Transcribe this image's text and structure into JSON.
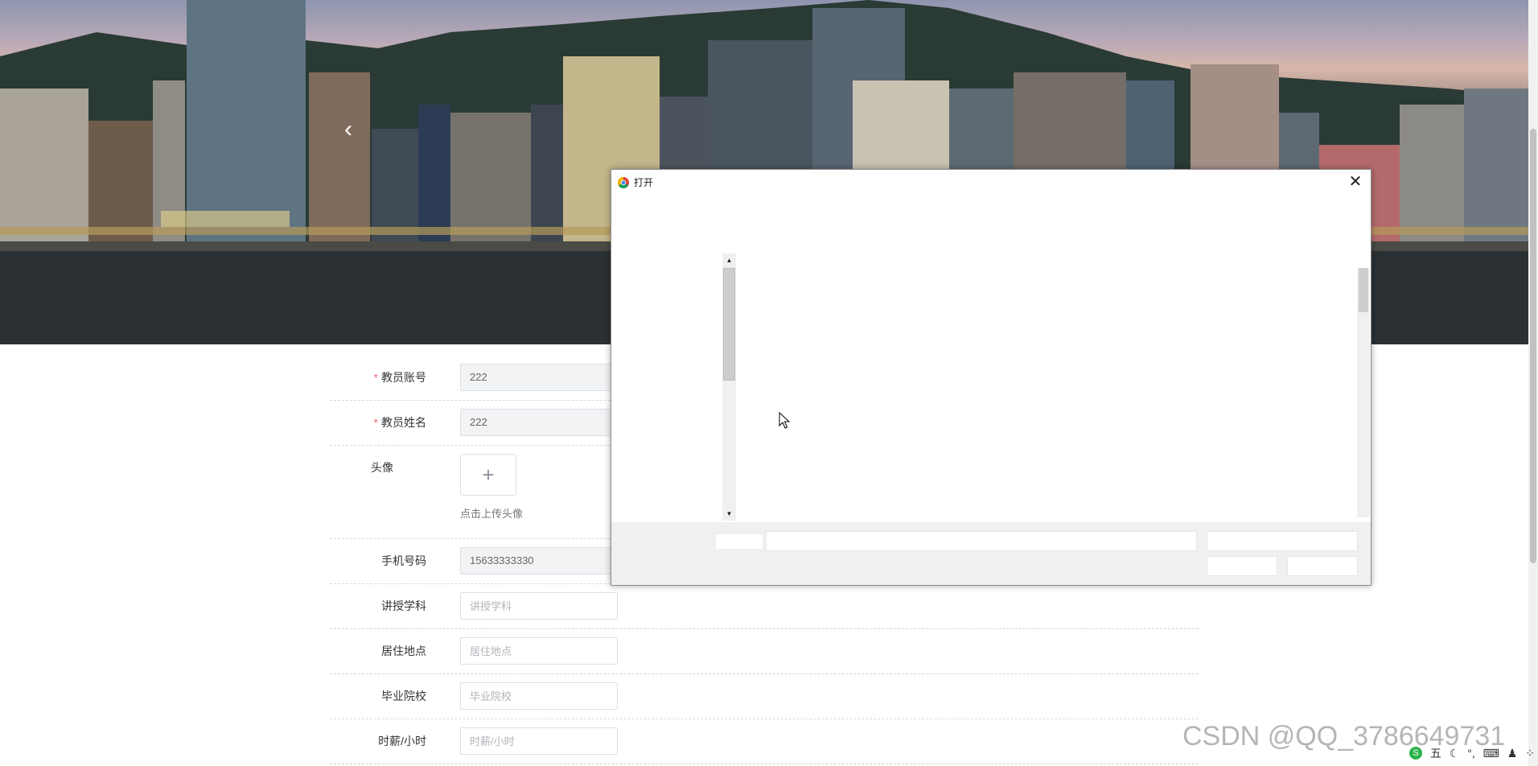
{
  "dialog": {
    "title": "打开",
    "close_glyph": "✕"
  },
  "banner": {
    "prev_glyph": "‹"
  },
  "form": {
    "account": {
      "label": "教员账号",
      "required_mark": "*",
      "value": "222"
    },
    "name": {
      "label": "教员姓名",
      "required_mark": "*",
      "value": "222"
    },
    "avatar": {
      "label": "头像",
      "upload_plus": "+",
      "upload_tip": "点击上传头像"
    },
    "phone": {
      "label": "手机号码",
      "value": "15633333330"
    },
    "subject": {
      "label": "讲授学科",
      "placeholder": "讲授学科"
    },
    "address": {
      "label": "居住地点",
      "placeholder": "居住地点"
    },
    "school": {
      "label": "毕业院校",
      "placeholder": "毕业院校"
    },
    "hourly_wage": {
      "label": "时薪/小时",
      "placeholder": "时薪/小时"
    }
  },
  "watermark": {
    "text": "CSDN @QQ_3786649731"
  },
  "tray": {
    "ime_logo": "S",
    "ime_mode": "五",
    "items": [
      "☾",
      "°,",
      "⌨",
      "♟",
      "⁘"
    ]
  },
  "colors": {
    "required": "#f56c6c",
    "input_border": "#dcdfe6",
    "dialog_footer_bg": "#f0f0f0"
  },
  "icons": [
    "chrome-icon",
    "close-icon",
    "chevron-left-icon",
    "plus-icon",
    "scroll-up-arrow-icon",
    "scroll-down-arrow-icon",
    "mouse-cursor-icon"
  ]
}
